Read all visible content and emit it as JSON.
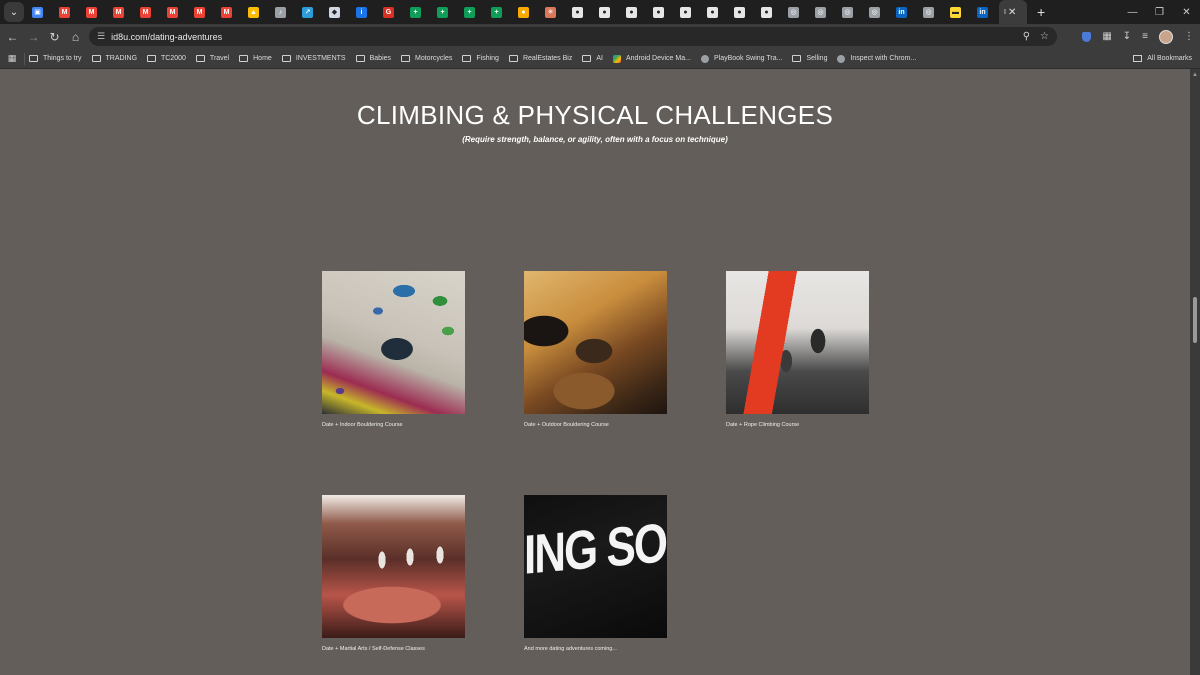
{
  "browser": {
    "tab_favicons": [
      {
        "icon": "docs-icon",
        "color": "#4285f4",
        "glyph": "▣"
      },
      {
        "icon": "gmail-icon",
        "color": "#ea4335",
        "glyph": "M"
      },
      {
        "icon": "gmail-icon",
        "color": "#ea4335",
        "glyph": "M"
      },
      {
        "icon": "gmail-icon",
        "color": "#ea4335",
        "glyph": "M"
      },
      {
        "icon": "gmail-icon",
        "color": "#ea4335",
        "glyph": "M"
      },
      {
        "icon": "gmail-icon",
        "color": "#ea4335",
        "glyph": "M"
      },
      {
        "icon": "gmail-icon",
        "color": "#ea4335",
        "glyph": "M"
      },
      {
        "icon": "gmail-icon",
        "color": "#ea4335",
        "glyph": "M"
      },
      {
        "icon": "drive-icon",
        "color": "#fbbc05",
        "glyph": "▲"
      },
      {
        "icon": "audio-icon",
        "color": "#9aa0a6",
        "glyph": "♪"
      },
      {
        "icon": "chart-icon",
        "color": "#2d9cdb",
        "glyph": "↗"
      },
      {
        "icon": "shield-icon",
        "color": "#cfd8e3",
        "glyph": "◆"
      },
      {
        "icon": "info-icon",
        "color": "#1a73e8",
        "glyph": "i"
      },
      {
        "icon": "app-icon",
        "color": "#d93025",
        "glyph": "G"
      },
      {
        "icon": "sheets-icon",
        "color": "#0f9d58",
        "glyph": "+"
      },
      {
        "icon": "sheets-icon",
        "color": "#0f9d58",
        "glyph": "+"
      },
      {
        "icon": "sheets-icon",
        "color": "#0f9d58",
        "glyph": "+"
      },
      {
        "icon": "sheets-icon",
        "color": "#0f9d58",
        "glyph": "+"
      },
      {
        "icon": "sun-icon",
        "color": "#f9ab00",
        "glyph": "●"
      },
      {
        "icon": "claude-icon",
        "color": "#d97757",
        "glyph": "✳"
      },
      {
        "icon": "github-icon",
        "color": "#e6e6e6",
        "glyph": "●"
      },
      {
        "icon": "github-icon",
        "color": "#e6e6e6",
        "glyph": "●"
      },
      {
        "icon": "github-icon",
        "color": "#e6e6e6",
        "glyph": "●"
      },
      {
        "icon": "github-icon",
        "color": "#e6e6e6",
        "glyph": "●"
      },
      {
        "icon": "github-icon",
        "color": "#e6e6e6",
        "glyph": "●"
      },
      {
        "icon": "github-icon",
        "color": "#e6e6e6",
        "glyph": "●"
      },
      {
        "icon": "github-icon",
        "color": "#e6e6e6",
        "glyph": "●"
      },
      {
        "icon": "github-icon",
        "color": "#e6e6e6",
        "glyph": "●"
      },
      {
        "icon": "globe-icon",
        "color": "#9aa0a6",
        "glyph": "◎"
      },
      {
        "icon": "globe-icon",
        "color": "#9aa0a6",
        "glyph": "◎"
      },
      {
        "icon": "globe-icon",
        "color": "#9aa0a6",
        "glyph": "◎"
      },
      {
        "icon": "globe-icon",
        "color": "#9aa0a6",
        "glyph": "◎"
      },
      {
        "icon": "linkedin-icon",
        "color": "#0a66c2",
        "glyph": "in"
      },
      {
        "icon": "globe-icon",
        "color": "#9aa0a6",
        "glyph": "◎"
      },
      {
        "icon": "flag-icon",
        "color": "#fdd835",
        "glyph": "▬"
      },
      {
        "icon": "linkedin-icon",
        "color": "#0a66c2",
        "glyph": "in"
      }
    ],
    "active_tab_glyph": "I",
    "url": "id8u.com/dating-adventures",
    "bookmarks": [
      {
        "label": "Things to try",
        "type": "folder"
      },
      {
        "label": "TRADING",
        "type": "folder"
      },
      {
        "label": "TC2000",
        "type": "folder"
      },
      {
        "label": "Travel",
        "type": "folder"
      },
      {
        "label": "Home",
        "type": "folder"
      },
      {
        "label": "INVESTMENTS",
        "type": "folder"
      },
      {
        "label": "Babies",
        "type": "folder"
      },
      {
        "label": "Motorcycles",
        "type": "folder"
      },
      {
        "label": "Fishing",
        "type": "folder"
      },
      {
        "label": "RealEstates Biz",
        "type": "folder"
      },
      {
        "label": "AI",
        "type": "folder"
      },
      {
        "label": "Android Device Ma...",
        "type": "android"
      },
      {
        "label": "PlayBook Swing Tra...",
        "type": "globe"
      },
      {
        "label": "Selling",
        "type": "folder"
      },
      {
        "label": "Inspect with Chrom...",
        "type": "globe"
      }
    ],
    "all_bookmarks_label": "All Bookmarks"
  },
  "page": {
    "heading": "CLIMBING & PHYSICAL CHALLENGES",
    "subheading": "(Require strength, balance, or agility, often with a focus on technique)",
    "cards": [
      {
        "caption": "Date + Indoor Bouldering Course",
        "image": "indoor-bouldering-photo"
      },
      {
        "caption": "Date + Outdoor Bouldering Course",
        "image": "outdoor-bouldering-photo"
      },
      {
        "caption": "Date + Rope Climbing Course",
        "image": "rope-climbing-photo"
      },
      {
        "caption": "Date + Martial Arts / Self-Defense Classes",
        "image": "martial-arts-photo"
      },
      {
        "caption": "And more dating adventures coming...",
        "image": "coming-soon-photo",
        "image_text": "ING SOON"
      }
    ]
  }
}
